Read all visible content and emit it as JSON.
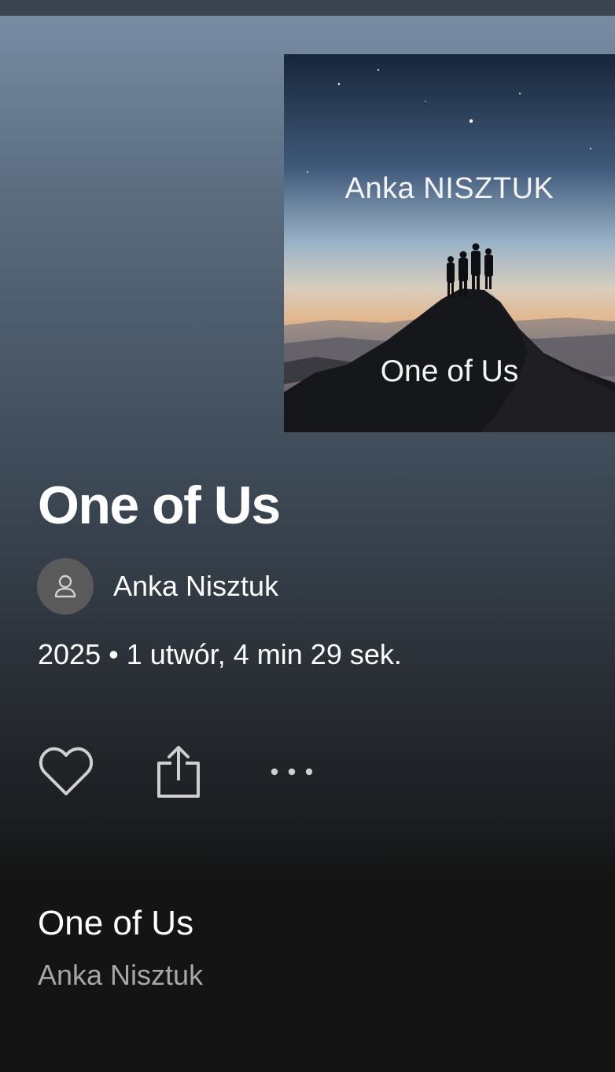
{
  "cover": {
    "artist_text": "Anka NISZTUK",
    "title_text": "One of Us"
  },
  "album": {
    "title": "One of Us",
    "artist": "Anka Nisztuk",
    "meta": "2025 • 1 utwór, 4 min 29 sek."
  },
  "actions": {
    "like_icon": "heart-outline-icon",
    "share_icon": "share-icon",
    "more_icon": "more-horizontal-icon"
  },
  "tracks": [
    {
      "title": "One of Us",
      "artist": "Anka Nisztuk"
    }
  ],
  "colors": {
    "background_top": "#7a8ea6",
    "background_bottom": "#121212",
    "secondary_text": "#a7a7a7",
    "avatar_bg": "#5a5a5a"
  }
}
